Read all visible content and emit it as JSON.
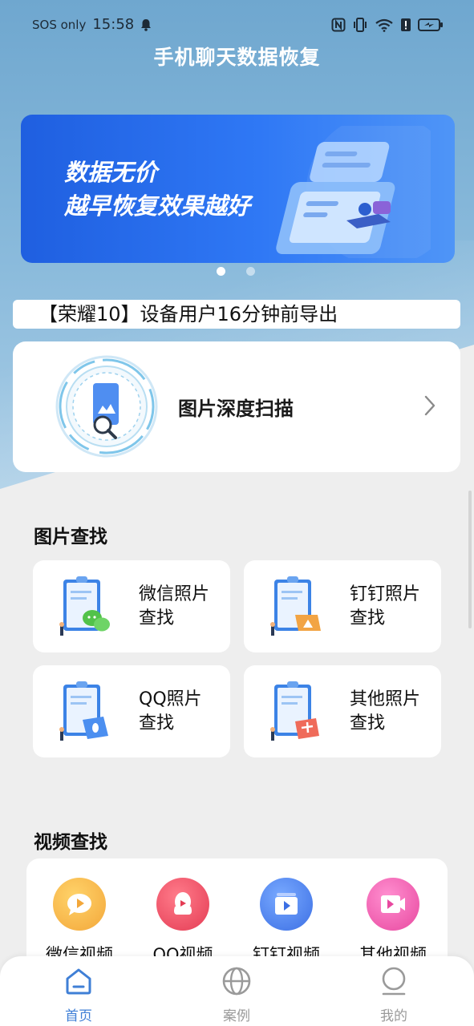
{
  "status_bar": {
    "carrier": "SOS only",
    "time": "15:58"
  },
  "app": {
    "title": "手机聊天数据恢复"
  },
  "banner": {
    "line1": "数据无价",
    "line2": "越早恢复效果越好",
    "page_count": 2,
    "active_page": 1
  },
  "ticker": {
    "text": "【荣耀10】设备用户16分钟前导出"
  },
  "deep_scan": {
    "label": "图片深度扫描"
  },
  "photo_section": {
    "title": "图片查找",
    "items": [
      {
        "label": "微信照片\n查找",
        "icon": "wechat-photo-icon"
      },
      {
        "label": "钉钉照片\n查找",
        "icon": "dingtalk-photo-icon"
      },
      {
        "label": "QQ照片\n查找",
        "icon": "qq-photo-icon"
      },
      {
        "label": "其他照片\n查找",
        "icon": "other-photo-icon"
      }
    ]
  },
  "video_section": {
    "title": "视频查找",
    "items": [
      {
        "label": "微信视频",
        "icon": "wechat-video-icon"
      },
      {
        "label": "QQ视频",
        "icon": "qq-video-icon"
      },
      {
        "label": "钉钉视频",
        "icon": "dingtalk-video-icon"
      },
      {
        "label": "其他视频",
        "icon": "other-video-icon"
      }
    ]
  },
  "bottom_nav": {
    "items": [
      {
        "label": "首页",
        "icon": "home-icon",
        "active": true
      },
      {
        "label": "案例",
        "icon": "globe-icon",
        "active": false
      },
      {
        "label": "我的",
        "icon": "profile-icon",
        "active": false
      }
    ]
  },
  "colors": {
    "accent": "#3f7fd6",
    "banner_blue": "#2f78f5",
    "header_bg": "#7fb2d6"
  }
}
